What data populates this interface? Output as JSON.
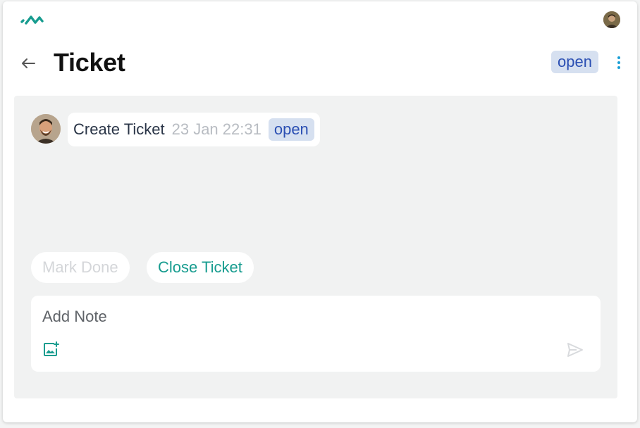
{
  "header": {
    "logo_icon": "brand-logo-icon",
    "user_avatar_icon": "user-avatar"
  },
  "page": {
    "back_icon": "arrow-left-icon",
    "title": "Ticket",
    "status": "open",
    "menu_icon": "more-vertical-icon"
  },
  "timeline": {
    "events": [
      {
        "title": "Create Ticket",
        "time": "23 Jan 22:31",
        "status": "open"
      }
    ]
  },
  "actions": {
    "mark_done_label": "Mark Done",
    "close_ticket_label": "Close Ticket"
  },
  "note": {
    "placeholder": "Add Note",
    "value": "",
    "image_icon": "add-image-icon",
    "send_icon": "send-icon"
  },
  "colors": {
    "accent": "#179c8f",
    "status_chip_bg": "#d6e0f0",
    "status_chip_text": "#2b4fb3",
    "menu_dots": "#1b9fd6"
  }
}
